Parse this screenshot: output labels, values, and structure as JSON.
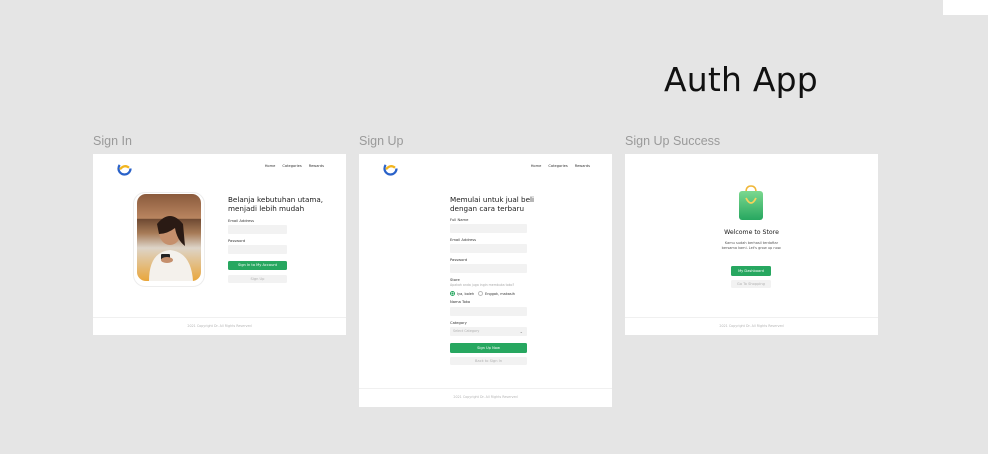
{
  "page_title": "Auth App",
  "frames": {
    "signin": {
      "label": "Sign In",
      "nav": [
        "Home",
        "Categories",
        "Rewards"
      ],
      "heading_line1": "Belanja kebutuhan utama,",
      "heading_line2": "menjadi lebih mudah",
      "email_label": "Email Address",
      "password_label": "Password",
      "primary_button": "Sign In to My Account",
      "secondary_button": "Sign Up",
      "footer": "2021 Copyright Dr. All Rights Reserved"
    },
    "signup": {
      "label": "Sign Up",
      "nav": [
        "Home",
        "Categories",
        "Rewards"
      ],
      "heading_line1": "Memulai untuk jual beli",
      "heading_line2": "dengan cara terbaru",
      "fullname_label": "Full Name",
      "email_label": "Email Address",
      "password_label": "Password",
      "store_label": "Store",
      "store_hint": "Apakah anda juga ingin membuka toko?",
      "radio_yes": "Iya, boleh",
      "radio_no": "Enggak, makasih",
      "store_name_label": "Nama Toko",
      "category_label": "Category",
      "category_placeholder": "Select Category",
      "primary_button": "Sign Up Now",
      "secondary_button": "Back to Sign In",
      "footer": "2021 Copyright Dr. All Rights Reserved"
    },
    "success": {
      "label": "Sign Up Success",
      "title": "Welcome to Store",
      "desc_line1": "Kamu sudah berhasil terdaftar",
      "desc_line2": "bersama kami. Let's grow up now.",
      "primary_button": "My Dashboard",
      "secondary_button": "Go To Shopping",
      "footer": "2021 Copyright Dr. All Rights Reserved"
    }
  },
  "colors": {
    "accent": "#27a760",
    "background": "#e5e5e5"
  }
}
